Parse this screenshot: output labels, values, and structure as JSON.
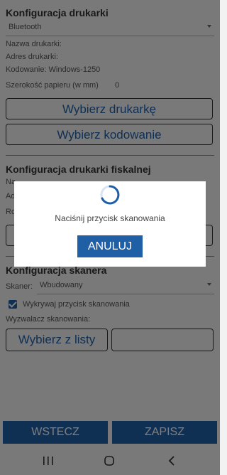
{
  "printer": {
    "title": "Konfiguracja drukarki",
    "connection_value": "Bluetooth",
    "name_label": "Nazwa drukarki:",
    "address_label": "Adres drukarki:",
    "encoding_label": "Kodowanie: Windows-1250",
    "paper_width_label": "Szerokość papieru (w mm)",
    "paper_width_value": "0",
    "choose_printer": "Wybierz drukarkę",
    "choose_encoding": "Wybierz kodowanie"
  },
  "fiscal": {
    "title": "Konfiguracja drukarki fiskalnej",
    "row1_partial": "Na",
    "row2_partial": "Ad",
    "row3_partial": "Ro"
  },
  "scanner": {
    "title": "Konfiguracja skanera",
    "scanner_label": "Skaner:",
    "scanner_value": "Wbudowany",
    "detect_button_label": "Wykrywaj przycisk skanowania",
    "trigger_label": "Wyzwalacz skanowania:",
    "choose_from_list": "Wybierz z listy",
    "detect_empty": ""
  },
  "footer": {
    "back": "WSTECZ",
    "save": "ZAPISZ"
  },
  "dialog": {
    "message": "Naciśnij przycisk skanowania",
    "cancel": "ANULUJ"
  },
  "icons": {
    "recents": "recents-icon",
    "home": "home-icon",
    "back": "back-icon"
  },
  "colors": {
    "accent": "#1f5fa6",
    "background": "#f2f2f2",
    "overlay": "rgba(0,0,0,0.5)"
  }
}
